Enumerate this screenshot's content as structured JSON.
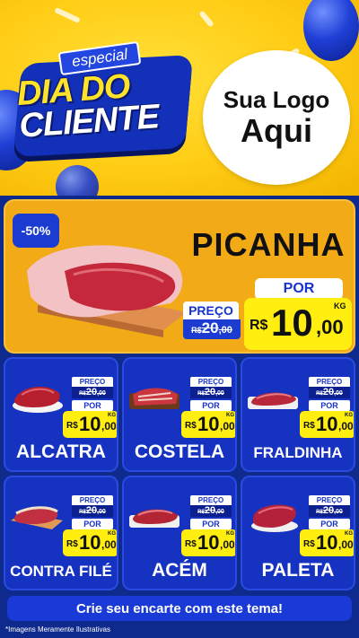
{
  "header": {
    "title_top": "especial",
    "title_line1": "DIA DO",
    "title_line2": "CLIENTE",
    "logo_line1": "Sua Logo",
    "logo_line2": "Aqui"
  },
  "featured": {
    "discount": "-50%",
    "name": "PICANHA",
    "preco_label": "PREÇO",
    "old_currency": "R$",
    "old_int": "20",
    "old_dec": ",00",
    "por_label": "POR",
    "currency": "R$",
    "price_int": "10",
    "price_dec": ",00",
    "unit": "KG"
  },
  "products": [
    {
      "name": "ALCATRA",
      "preco_label": "PREÇO",
      "old_currency": "R$",
      "old_int": "20",
      "old_dec": ",00",
      "por_label": "POR",
      "currency": "R$",
      "price_int": "10",
      "price_dec": ",00",
      "unit": "KG"
    },
    {
      "name": "COSTELA",
      "preco_label": "PREÇO",
      "old_currency": "R$",
      "old_int": "20",
      "old_dec": ",00",
      "por_label": "POR",
      "currency": "R$",
      "price_int": "10",
      "price_dec": ",00",
      "unit": "KG"
    },
    {
      "name": "FRALDINHA",
      "preco_label": "PREÇO",
      "old_currency": "R$",
      "old_int": "20",
      "old_dec": ",00",
      "por_label": "POR",
      "currency": "R$",
      "price_int": "10",
      "price_dec": ",00",
      "unit": "KG"
    },
    {
      "name": "CONTRA FILÉ",
      "preco_label": "PREÇO",
      "old_currency": "R$",
      "old_int": "20",
      "old_dec": ",00",
      "por_label": "POR",
      "currency": "R$",
      "price_int": "10",
      "price_dec": ",00",
      "unit": "KG"
    },
    {
      "name": "ACÉM",
      "preco_label": "PREÇO",
      "old_currency": "R$",
      "old_int": "20",
      "old_dec": ",00",
      "por_label": "POR",
      "currency": "R$",
      "price_int": "10",
      "price_dec": ",00",
      "unit": "KG"
    },
    {
      "name": "PALETA",
      "preco_label": "PREÇO",
      "old_currency": "R$",
      "old_int": "20",
      "old_dec": ",00",
      "por_label": "POR",
      "currency": "R$",
      "price_int": "10",
      "price_dec": ",00",
      "unit": "KG"
    }
  ],
  "footer": {
    "cta": "Crie seu encarte com este tema!",
    "disclaimer": "*Imagens Meramente Ilustrativas"
  },
  "colors": {
    "brand_blue": "#1632c0",
    "accent_yellow": "#ffee10",
    "hero_orange": "#f2aa17"
  }
}
